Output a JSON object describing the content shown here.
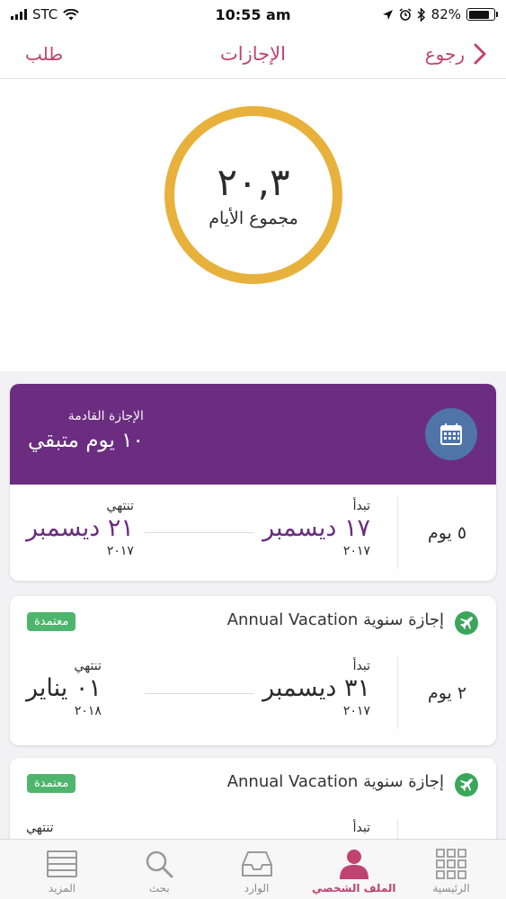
{
  "status_bar": {
    "carrier": "STC",
    "time": "10:55 am",
    "battery": "82%",
    "battery_level": 0.82
  },
  "nav": {
    "back_label": "رجوع",
    "title": "الإجازات",
    "action_label": "طلب"
  },
  "summary": {
    "total_value": "٢٠,٣",
    "total_label": "مجموع الأيام"
  },
  "upcoming": {
    "heading": "الإجازة القادمة",
    "remaining": "١٠ يوم متبقي",
    "days": "٥ يوم",
    "start_label": "تبدأ",
    "start_date": "١٧ ديسمبر",
    "start_year": "٢٠١٧",
    "end_label": "تنتهي",
    "end_date": "٢١ ديسمبر",
    "end_year": "٢٠١٧"
  },
  "vacations": [
    {
      "title": "إجازة سنوية Annual Vacation",
      "status": "معتمدة",
      "days": "٢ يوم",
      "start_label": "تبدأ",
      "start_date": "٣١ ديسمبر",
      "start_year": "٢٠١٧",
      "end_label": "تنتهي",
      "end_date": "٠١ يناير",
      "end_year": "٢٠١٨"
    },
    {
      "title": "إجازة سنوية Annual Vacation",
      "status": "معتمدة",
      "start_label": "تبدأ",
      "end_label": "تنتهي"
    }
  ],
  "tabs": [
    {
      "label": "المزيد",
      "icon": "menu-lines-icon"
    },
    {
      "label": "بحث",
      "icon": "search-icon"
    },
    {
      "label": "الوارد",
      "icon": "inbox-tray-icon"
    },
    {
      "label": "الملف الشخصي",
      "icon": "profile-icon",
      "active": true
    },
    {
      "label": "الرئيسية",
      "icon": "grid-icon"
    }
  ],
  "colors": {
    "accent": "#c0436f",
    "purple": "#6b2d80",
    "ring": "#e8b13c",
    "approved": "#4eb56c",
    "calendar_badge": "#4e74a8"
  }
}
